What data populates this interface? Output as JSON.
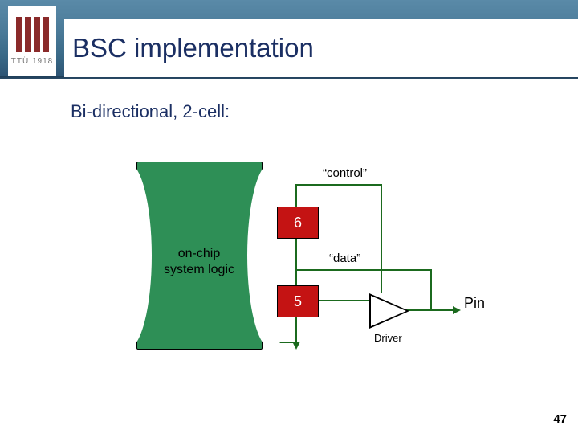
{
  "logo": {
    "text": "TTÜ 1918"
  },
  "title": "BSC implementation",
  "subtitle": "Bi-directional, 2-cell:",
  "diagram": {
    "chip_label_line1": "on-chip",
    "chip_label_line2": "system logic",
    "cell_top": "6",
    "cell_bottom": "5",
    "label_control": "“control”",
    "label_data": "“data”",
    "label_driver": "Driver",
    "label_pin": "Pin"
  },
  "page_number": "47"
}
